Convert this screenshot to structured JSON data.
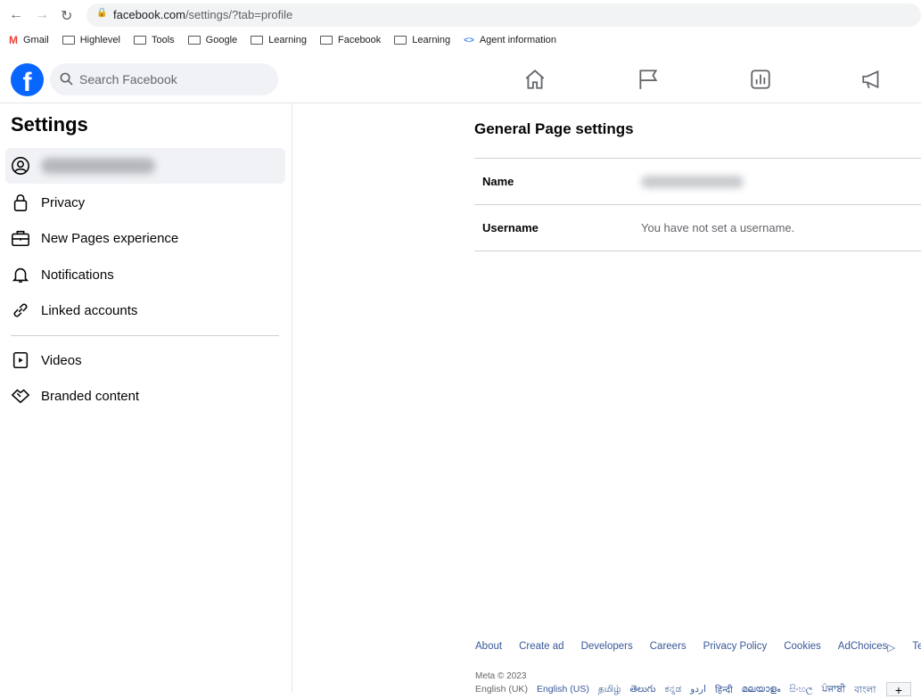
{
  "browser": {
    "url_host": "facebook.com",
    "url_path": "/settings/?tab=profile",
    "bookmarks": [
      {
        "label": "Gmail",
        "icon": "gmail-icon"
      },
      {
        "label": "Highlevel",
        "icon": "folder-icon"
      },
      {
        "label": "Tools",
        "icon": "folder-icon"
      },
      {
        "label": "Google",
        "icon": "folder-icon"
      },
      {
        "label": "Learning",
        "icon": "folder-icon"
      },
      {
        "label": "Facebook",
        "icon": "folder-icon"
      },
      {
        "label": "Learning",
        "icon": "folder-icon"
      },
      {
        "label": "Agent information",
        "icon": "code-icon"
      }
    ]
  },
  "header": {
    "logo": "f",
    "search_placeholder": "Search Facebook"
  },
  "sidebar": {
    "title": "Settings",
    "items": [
      {
        "label": "Privacy"
      },
      {
        "label": "New Pages experience"
      },
      {
        "label": "Notifications"
      },
      {
        "label": "Linked accounts"
      },
      {
        "label": "Videos"
      },
      {
        "label": "Branded content"
      }
    ]
  },
  "main": {
    "title": "General Page settings",
    "rows": [
      {
        "label": "Name",
        "value": ""
      },
      {
        "label": "Username",
        "value": "You have not set a username."
      }
    ]
  },
  "footer": {
    "links": [
      "About",
      "Create ad",
      "Developers",
      "Careers",
      "Privacy Policy",
      "Cookies",
      "AdChoices",
      "Terms"
    ],
    "copyright": "Meta © 2023",
    "languages": [
      "English (UK)",
      "English (US)",
      "தமிழ்",
      "తెలుగు",
      "ಕನ್ನಡ",
      "اردو",
      "हिन्दी",
      "മലയാളം",
      "සිංහල",
      "ਪੰਜਾਬੀ",
      "বাংলা"
    ],
    "more": "+"
  },
  "colors": {
    "brand": "#0866ff"
  }
}
